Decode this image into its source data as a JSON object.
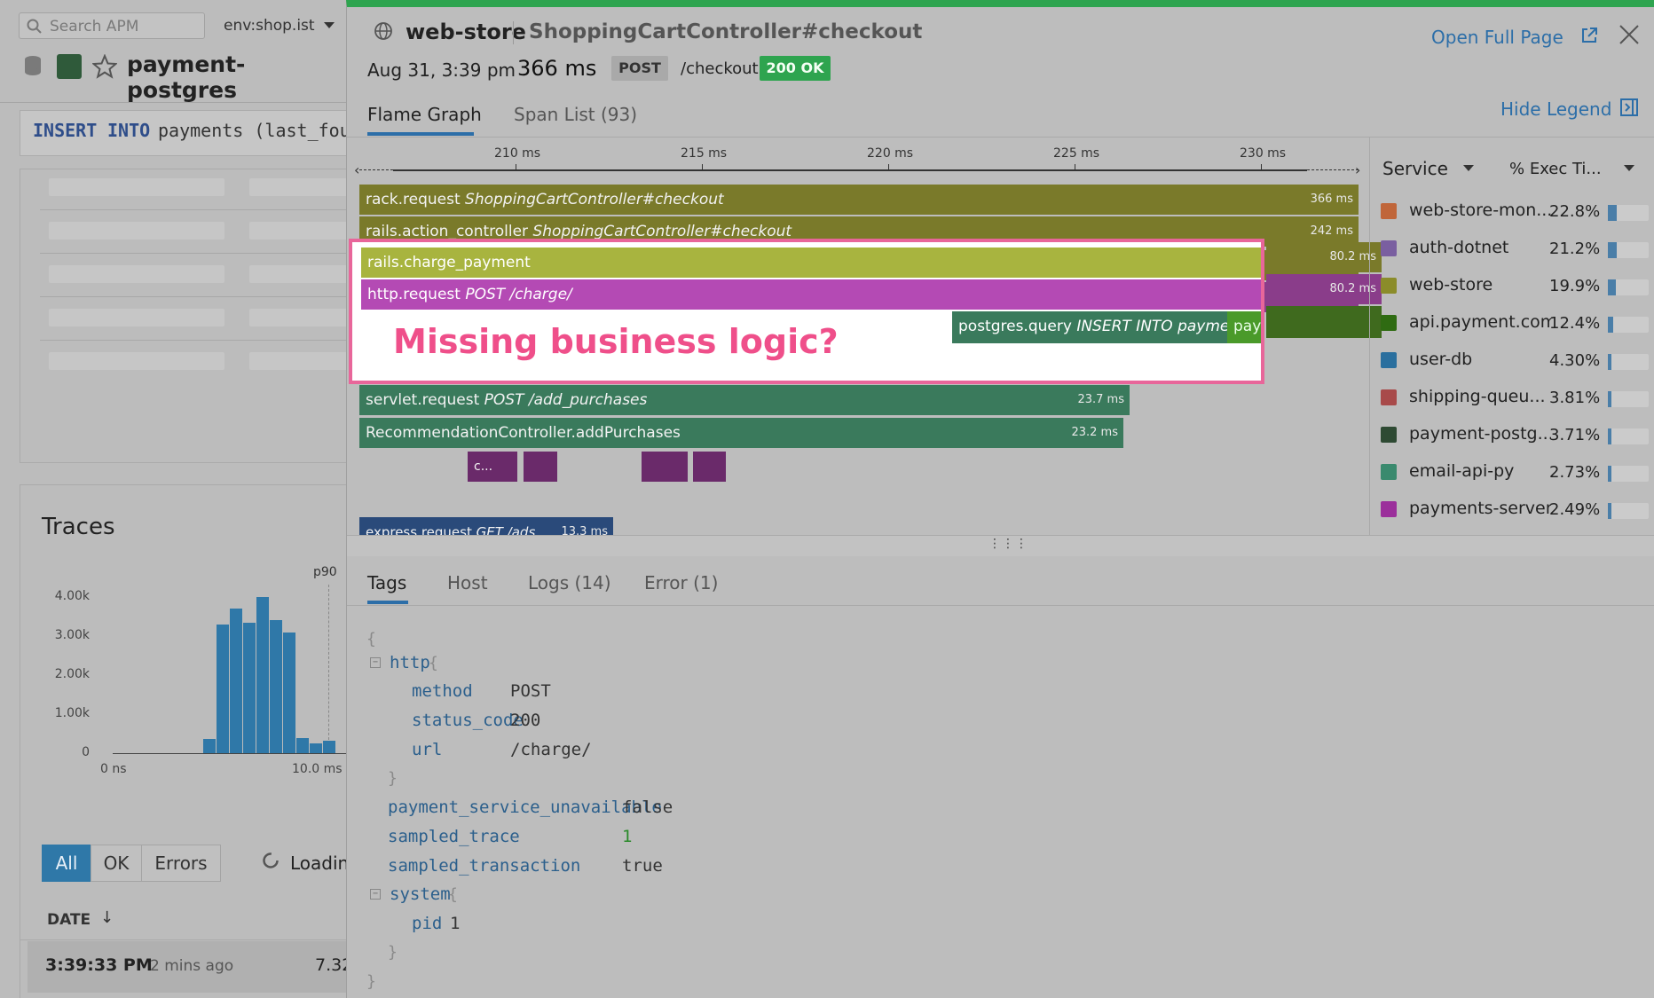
{
  "bg": {
    "search_placeholder": "Search APM",
    "env_label": "env:shop.ist",
    "service_name": "payment-postgres",
    "sql_keyword1": "INSERT",
    "sql_keyword2": "INTO",
    "sql_rest": "payments (last_fou",
    "traces_title": "Traces",
    "hist": {
      "p90_label": "p90",
      "y_ticks": [
        "4.00k",
        "3.00k",
        "2.00k",
        "1.00k",
        "0"
      ],
      "x_ticks": [
        "0 ns",
        "10.0 ms"
      ],
      "bars": [
        360,
        3300,
        3700,
        3350,
        4000,
        3400,
        3100,
        380,
        250,
        320
      ]
    },
    "filters": [
      "All",
      "OK",
      "Errors"
    ],
    "loading_label": "Loadin",
    "date_header": "DATE",
    "sort_icon": "arrow-down-icon",
    "row_time": "3:39:33 PM",
    "row_ago": "2 mins ago",
    "row_dur": "7.32"
  },
  "modal": {
    "service": "web-store",
    "resource": "ShoppingCartController#checkout",
    "date": "Aug 31, 3:39 pm",
    "duration": "366 ms",
    "method": "POST",
    "path": "/checkout",
    "status": "200 OK",
    "open_full_page": "Open Full Page",
    "tabs": [
      "Flame Graph",
      "Span List (93)"
    ],
    "hide_legend": "Hide Legend",
    "accent": "#2ea44f",
    "timeline_ticks": [
      "210 ms",
      "215 ms",
      "220 ms",
      "225 ms",
      "230 ms"
    ],
    "spans": [
      {
        "name": "rack.request",
        "res": "ShoppingCartController#checkout",
        "dur": "366 ms"
      },
      {
        "name": "rails.action_controller",
        "res": "ShoppingCartController#checkout",
        "dur": "242 ms"
      },
      {
        "name": "rails.charge_payment",
        "res": "",
        "dur": "80.2 ms"
      },
      {
        "name": "http.request",
        "res": "POST /charge/",
        "dur": "80.2 ms"
      },
      {
        "name": "postgres.query",
        "res": "INSERT INTO payments ...",
        "dur": ""
      },
      {
        "name": "payment_api",
        "res": "",
        "dur": ""
      },
      {
        "name": "servlet.request",
        "res": "POST /add_purchases",
        "dur": "23.7 ms"
      },
      {
        "name": "RecommendationController.addPurchases",
        "res": "",
        "dur": "23.2 ms"
      },
      {
        "name": "c...",
        "res": "",
        "dur": ""
      },
      {
        "name": "express.request",
        "res": "GET /ads",
        "dur": "13.3 ms"
      }
    ],
    "annotation": "Missing business logic?",
    "legend": {
      "col_service": "Service",
      "col_exec": "% Exec Ti...",
      "rows": [
        {
          "name": "web-store-mon...",
          "pct": "22.8%",
          "color": "#c0663a",
          "frac": 0.228
        },
        {
          "name": "auth-dotnet",
          "pct": "21.2%",
          "color": "#7a5fa0",
          "frac": 0.212
        },
        {
          "name": "web-store",
          "pct": "19.9%",
          "color": "#8b8c2a",
          "frac": 0.199
        },
        {
          "name": "api.payment.com",
          "pct": "12.4%",
          "color": "#2f6b12",
          "frac": 0.124
        },
        {
          "name": "user-db",
          "pct": "4.30%",
          "color": "#2a6f9e",
          "frac": 0.043
        },
        {
          "name": "shipping-queu...",
          "pct": "3.81%",
          "color": "#a84a4a",
          "frac": 0.0381
        },
        {
          "name": "payment-postg...",
          "pct": "3.71%",
          "color": "#2e4a33",
          "frac": 0.0371
        },
        {
          "name": "email-api-py",
          "pct": "2.73%",
          "color": "#3a8a6e",
          "frac": 0.0273
        },
        {
          "name": "payments-server",
          "pct": "2.49%",
          "color": "#9b2f9b",
          "frac": 0.0249
        }
      ]
    },
    "detail_tabs": [
      "Tags",
      "Host",
      "Logs (14)",
      "Error (1)"
    ],
    "tags": {
      "open_brace": "{",
      "close_brace": "}",
      "http_key": "http",
      "method_key": "method",
      "method_val": "POST",
      "status_key": "status_code",
      "status_val": "200",
      "url_key": "url",
      "url_val": "/charge/",
      "psu_key": "payment_service_unavailable",
      "psu_val": "false",
      "st_key": "sampled_trace",
      "st_val": "1",
      "stx_key": "sampled_transaction",
      "stx_val": "true",
      "system_key": "system",
      "pid_key": "pid",
      "pid_val": "1"
    }
  }
}
